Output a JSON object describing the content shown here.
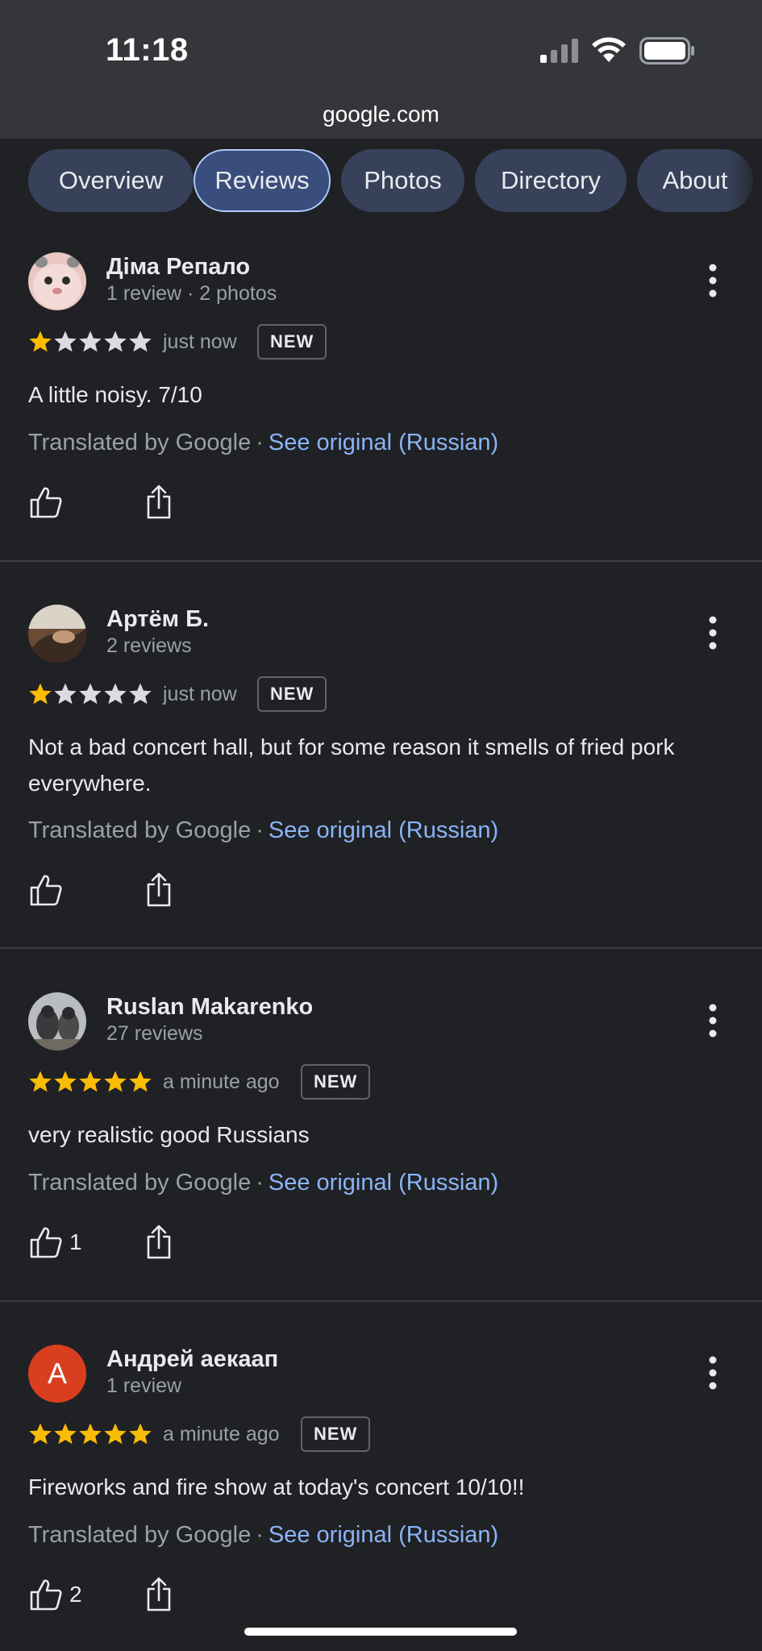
{
  "status_bar": {
    "time": "11:18"
  },
  "browser": {
    "url": "google.com"
  },
  "tabs": [
    {
      "label": "Overview",
      "active": false
    },
    {
      "label": "Reviews",
      "active": true
    },
    {
      "label": "Photos",
      "active": false
    },
    {
      "label": "Directory",
      "active": false
    },
    {
      "label": "About",
      "active": false
    }
  ],
  "reviews": [
    {
      "name": "Діма Репало",
      "meta": "1 review · 2 photos",
      "rating": 1,
      "time": "just now",
      "badge": "NEW",
      "text": "A little noisy. 7/10",
      "translated": "Translated by Google",
      "see_original": "See original (Russian)",
      "likes": ""
    },
    {
      "name": "Артём Б.",
      "meta": "2 reviews",
      "rating": 1,
      "time": "just now",
      "badge": "NEW",
      "text": "Not a bad concert hall, but for some reason it smells of fried pork everywhere.",
      "translated": "Translated by Google",
      "see_original": "See original (Russian)",
      "likes": ""
    },
    {
      "name": "Ruslan Makarenko",
      "meta": "27 reviews",
      "rating": 5,
      "time": "a minute ago",
      "badge": "NEW",
      "text": "very realistic good Russians",
      "translated": "Translated by Google",
      "see_original": "See original (Russian)",
      "likes": "1"
    },
    {
      "name": "Андрей аекаап",
      "meta": "1 review",
      "avatar_letter": "А",
      "rating": 5,
      "time": "a minute ago",
      "badge": "NEW",
      "text": "Fireworks and fire show at today's concert 10/10!!",
      "translated": "Translated by Google",
      "see_original": "See original (Russian)",
      "likes": "2"
    }
  ],
  "colors": {
    "background": "#202124",
    "chrome": "#35363a",
    "star_filled": "#fbbc04",
    "star_empty": "#dadce0",
    "link": "#8ab4f8",
    "avatar_letter_bg": "#d93f1e"
  }
}
